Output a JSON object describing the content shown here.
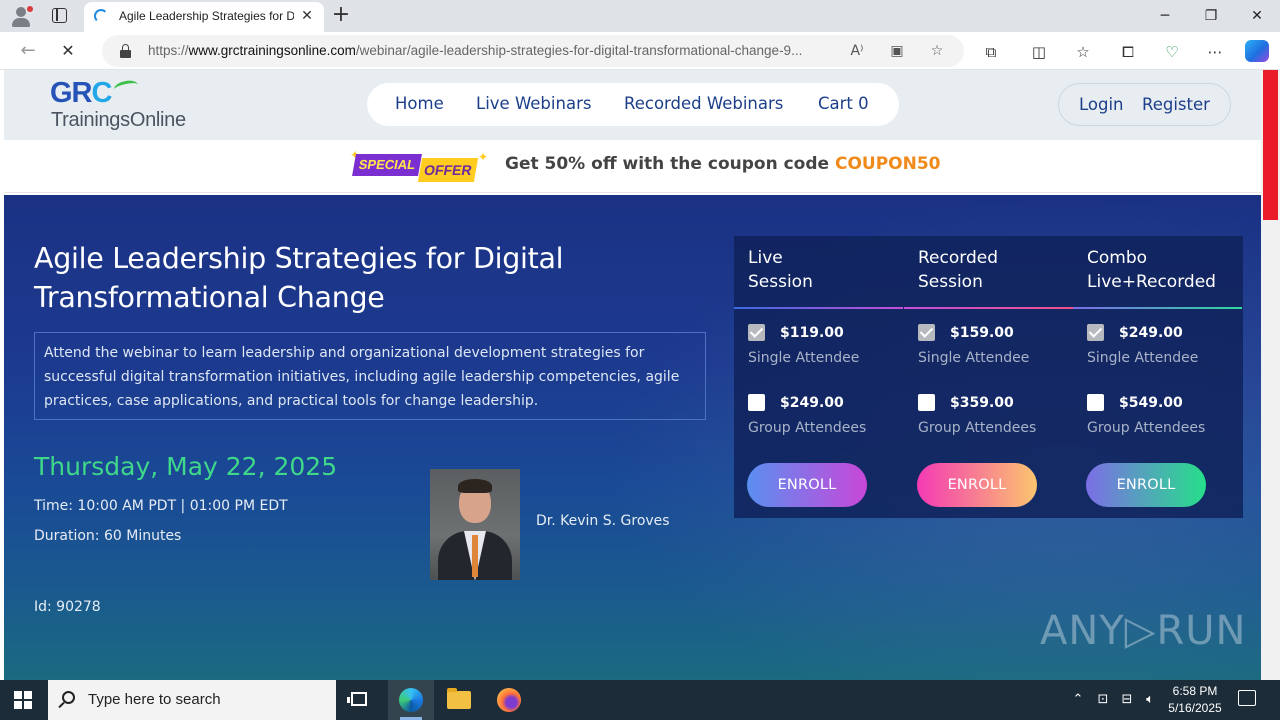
{
  "browser": {
    "tab_title": "Agile Leadership Strategies for Di",
    "tab_close": "✕",
    "new_tab": "+",
    "url_prefix": "https://",
    "url_domain": "www.grctrainingsonline.com",
    "url_path": "/webinar/agile-leadership-strategies-for-digital-transformational-change-9...",
    "window_controls": [
      "─",
      "❐",
      "✕"
    ]
  },
  "site": {
    "logo_grc_main": "GR",
    "logo_grc_c": "C",
    "logo_sub": "TrainingsOnline",
    "nav": [
      "Home",
      "Live Webinars",
      "Recorded Webinars",
      "Cart 0"
    ],
    "auth": [
      "Login",
      "Register"
    ],
    "offer_badge_top": "SPECIAL",
    "offer_badge_bottom": "OFFER",
    "offer_text": "Get 50% off with the coupon code ",
    "coupon_code": "COUPON50"
  },
  "webinar": {
    "title": "Agile Leadership Strategies for Digital Transformational Change",
    "description": "Attend the webinar to learn leadership and organizational development strategies for successful digital transformation initiatives, including agile leadership competencies, agile practices, case applications, and practical tools for change leadership.",
    "date": "Thursday, May 22, 2025",
    "time": "Time: 10:00 AM PDT | 01:00 PM EDT",
    "duration": "Duration: 60 Minutes",
    "id": "Id: 90278",
    "speaker": "Dr. Kevin S. Groves"
  },
  "pricing": {
    "columns": [
      {
        "title_line1": "Live",
        "title_line2": "Session",
        "single_price": "$119.00",
        "single_label": "Single Attendee",
        "single_checked": true,
        "group_price": "$249.00",
        "group_label": "Group Attendees",
        "group_checked": false,
        "enroll": "ENROLL"
      },
      {
        "title_line1": "Recorded",
        "title_line2": "Session",
        "single_price": "$159.00",
        "single_label": "Single Attendee",
        "single_checked": true,
        "group_price": "$359.00",
        "group_label": "Group Attendees",
        "group_checked": false,
        "enroll": "ENROLL"
      },
      {
        "title_line1": "Combo",
        "title_line2": "Live+Recorded",
        "single_price": "$249.00",
        "single_label": "Single Attendee",
        "single_checked": true,
        "group_price": "$549.00",
        "group_label": "Group Attendees",
        "group_checked": false,
        "enroll": "ENROLL"
      }
    ]
  },
  "watermark": "ANY▷RUN",
  "taskbar": {
    "search_placeholder": "Type here to search",
    "time": "6:58 PM",
    "date": "5/16/2025"
  },
  "colors": {
    "accent_green": "#3fd78a",
    "coupon_orange": "#f08a1a",
    "nav_blue": "#1c3f8a",
    "scroll_red": "#ea1c2a"
  }
}
